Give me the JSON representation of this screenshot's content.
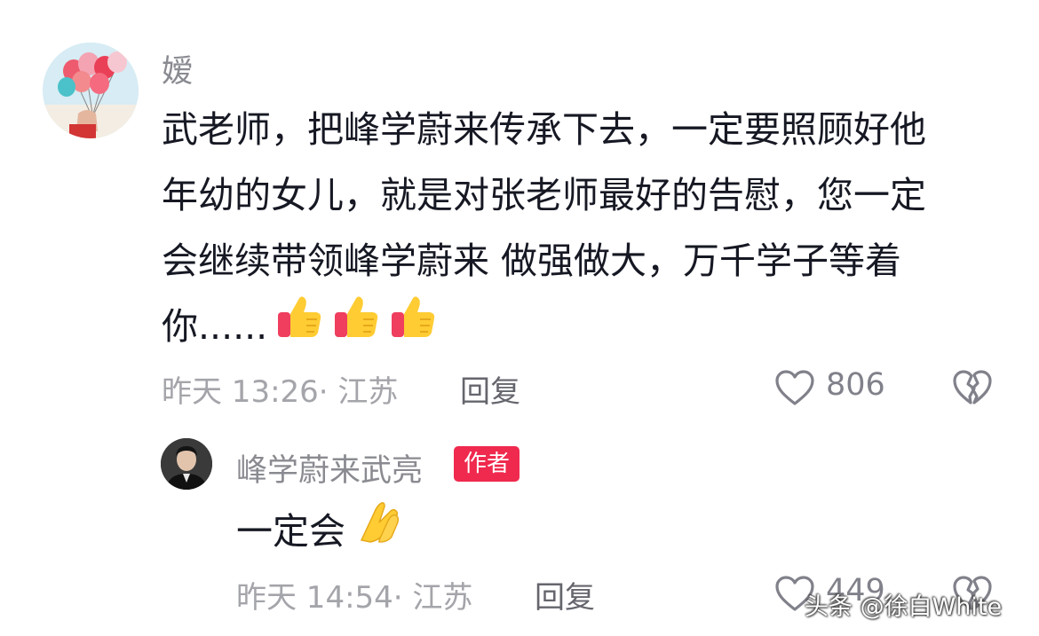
{
  "comment": {
    "username": "嫒",
    "text_lines": [
      "武老师，把峰学蔚来传承下去，一定要照顾好他",
      "年幼的女儿，就是对张老师最好的告慰，您一定",
      "会继续带领峰学蔚来 做强做大，万千学子等着",
      "你......"
    ],
    "emojis": [
      "thumbs-up-icon",
      "thumbs-up-icon",
      "thumbs-up-icon"
    ],
    "meta": "昨天 13:26· 江苏",
    "reply_label": "回复",
    "like_count": "806"
  },
  "reply": {
    "username": "峰学蔚来武亮",
    "badge": "作者",
    "text": "一定会",
    "emoji": "pray-hands-icon",
    "meta": "昨天 14:54· 江苏",
    "reply_label": "回复",
    "like_count": "449"
  },
  "watermark": "头条 @徐白White",
  "colors": {
    "badge": "#f0294e",
    "meta_text": "#a4a5aa",
    "username": "#8a8b91",
    "body_text": "#161823"
  }
}
